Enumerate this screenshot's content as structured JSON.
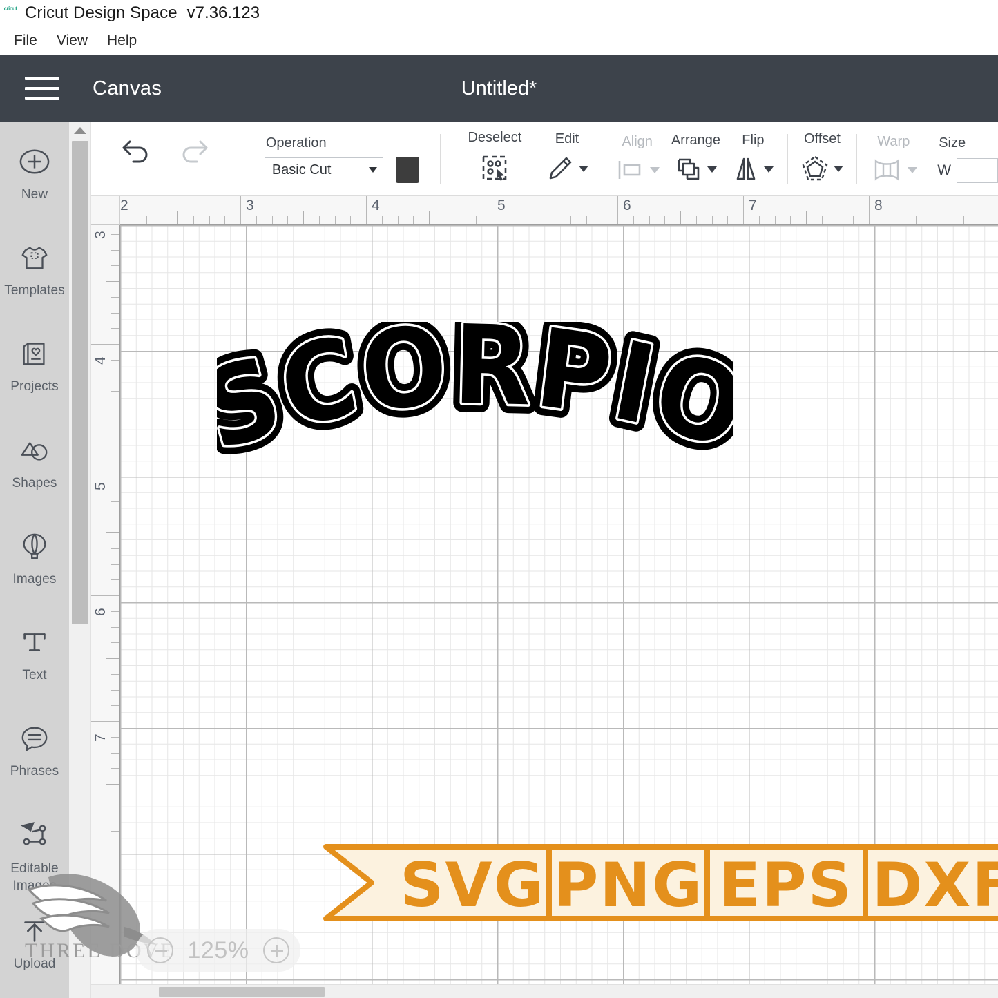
{
  "window": {
    "app_logo": "cricut",
    "title": "Cricut Design Space",
    "version": "v7.36.123",
    "menu": [
      "File",
      "View",
      "Help"
    ]
  },
  "header": {
    "menu_icon": "hamburger-icon",
    "canvas_label": "Canvas",
    "document_title": "Untitled*",
    "background": "#3d434b"
  },
  "sidebar": {
    "items": [
      {
        "label": "New",
        "icon": "plus-circle-icon"
      },
      {
        "label": "Templates",
        "icon": "tshirt-icon"
      },
      {
        "label": "Projects",
        "icon": "card-heart-icon"
      },
      {
        "label": "Shapes",
        "icon": "shapes-icon"
      },
      {
        "label": "Images",
        "icon": "hot-air-balloon-icon"
      },
      {
        "label": "Text",
        "icon": "text-t-icon"
      },
      {
        "label": "Phrases",
        "icon": "speech-bubble-icon"
      },
      {
        "label": "Editable Images",
        "icon": "node-path-icon"
      },
      {
        "label": "Upload",
        "icon": "upload-arrow-icon"
      }
    ]
  },
  "toolbar": {
    "undo": "undo-icon",
    "redo": "redo-icon",
    "operation_label": "Operation",
    "operation_value": "Basic Cut",
    "operation_options": [
      "Basic Cut"
    ],
    "color_swatch": "#3d3d3d",
    "buttons": [
      {
        "label": "Deselect",
        "icon": "deselect-icon",
        "disabled": false,
        "caret": false
      },
      {
        "label": "Edit",
        "icon": "pencil-icon",
        "disabled": false,
        "caret": true
      },
      {
        "label": "Align",
        "icon": "align-icon",
        "disabled": true,
        "caret": true
      },
      {
        "label": "Arrange",
        "icon": "arrange-icon",
        "disabled": false,
        "caret": true
      },
      {
        "label": "Flip",
        "icon": "flip-icon",
        "disabled": false,
        "caret": true
      },
      {
        "label": "Offset",
        "icon": "offset-icon",
        "disabled": false,
        "caret": true
      },
      {
        "label": "Warp",
        "icon": "warp-icon",
        "disabled": true,
        "caret": true
      }
    ],
    "size_label": "Size",
    "width_label": "W",
    "width_value": ""
  },
  "rulers": {
    "horizontal_ticks": [
      "2",
      "3",
      "4",
      "5",
      "6",
      "7",
      "8"
    ],
    "vertical_ticks": [
      "3",
      "4",
      "5",
      "6",
      "7"
    ],
    "unit": "in"
  },
  "canvas": {
    "artwork_text": "SCORPIO",
    "artwork_fill": "#000000",
    "artwork_outline": "#ffffff",
    "grid_minor_color": "#e6e6e6",
    "grid_major_color": "#b9b9b9"
  },
  "zoom_control": {
    "minus": "minus-circle-icon",
    "value": "125%",
    "plus": "plus-circle-icon"
  },
  "watermark": {
    "brand": "THREE DOVE",
    "logo": "dove-icon"
  },
  "format_banner": {
    "formats": [
      "SVG",
      "PNG",
      "EPS",
      "DXF"
    ],
    "accent": "#E4901C",
    "fill": "#FCF2DF"
  }
}
